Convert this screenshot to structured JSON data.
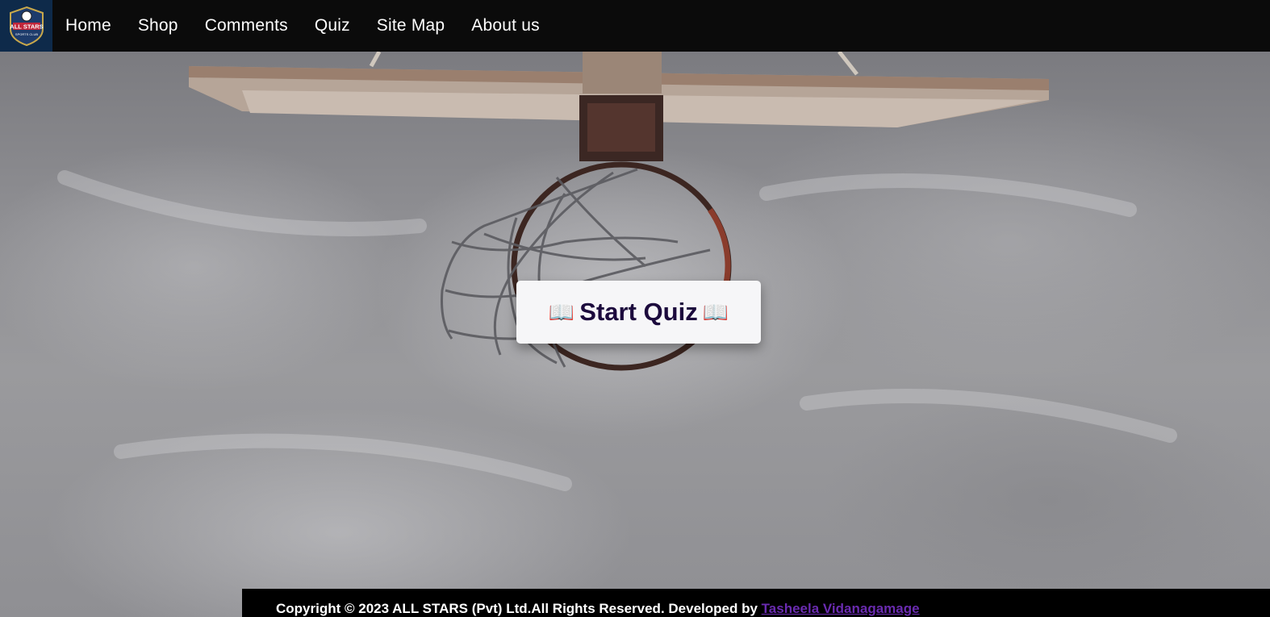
{
  "nav": {
    "logo_text": "ALL STARS",
    "logo_subtext": "SPORTS CLUB",
    "items": [
      {
        "label": "Home"
      },
      {
        "label": "Shop"
      },
      {
        "label": "Comments"
      },
      {
        "label": "Quiz"
      },
      {
        "label": "Site Map"
      },
      {
        "label": "About us"
      }
    ]
  },
  "hero": {
    "icon": "book-emoji",
    "button_label": "Start Quiz",
    "book_glyph": "📖"
  },
  "footer": {
    "copyright": "Copyright © 2023 ALL STARS (Pvt) Ltd.All Rights Reserved. Developed by",
    "developer": "Tasheela Vidanagamage"
  },
  "colors": {
    "navbar_bg": "#0b0b0b",
    "button_text": "#1c0a3d",
    "footer_link": "#6a2bb0"
  }
}
